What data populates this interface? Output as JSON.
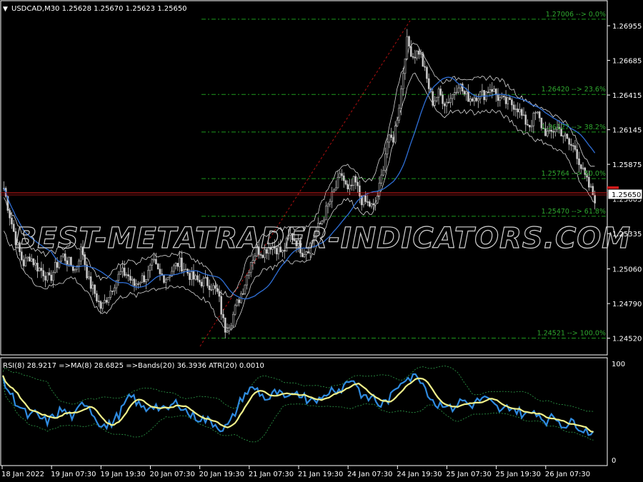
{
  "main_panel": {
    "header": "USDCAD,M30  1.25628 1.25670 1.25623 1.25650",
    "price_axis_ticks": [
      "1.26955",
      "1.26685",
      "1.26415",
      "1.26145",
      "1.25875",
      "1.25605",
      "1.25335",
      "1.25060",
      "1.24790",
      "1.24520"
    ],
    "current_price": "1.25650",
    "fib_levels": [
      {
        "label": "1.27006 --> 0.0%",
        "price": 1.27006
      },
      {
        "label": "1.26420 --> 23.6%",
        "price": 1.2642
      },
      {
        "label": "1.26127 --> 38.2%",
        "price": 1.26127
      },
      {
        "label": "1.25764 --> 50.0%",
        "price": 1.25764
      },
      {
        "label": "1.25470 --> 61.8%",
        "price": 1.2547
      },
      {
        "label": "1.24521 --> 100.0%",
        "price": 1.24521
      }
    ],
    "watermark": "BEST-METATRADER-INDICATORS.COM"
  },
  "sub_panel": {
    "header": "RSI(8) 28.9217  =>MA(8) 28.6825  =>Bands(20) 36.3936  ATR(20) 0.0010",
    "axis_ticks": [
      "100",
      "0"
    ]
  },
  "time_axis": [
    "18 Jan 2022",
    "19 Jan 07:30",
    "19 Jan 19:30",
    "20 Jan 07:30",
    "20 Jan 19:30",
    "21 Jan 07:30",
    "21 Jan 19:30",
    "24 Jan 07:30",
    "24 Jan 19:30",
    "25 Jan 07:30",
    "25 Jan 19:30",
    "26 Jan 07:30"
  ],
  "colors": {
    "background": "#000000",
    "grid": "#ffffff",
    "candle": "#c8c8c8",
    "fib": "#1e9a1e",
    "fib_label": "#2fa82f",
    "ma": "#2f6fd6",
    "rsi": "#2f8be0",
    "rsi_ma": "#f0f08a",
    "band": "#2ea04a",
    "current_line": "#d11a1a",
    "diag": "#b01010"
  },
  "chart_data": {
    "type": "candlestick",
    "symbol": "USDCAD",
    "timeframe": "M30",
    "price_range": [
      1.2439,
      1.2715
    ],
    "close_path": [
      1.2569,
      1.2546,
      1.2525,
      1.251,
      1.2516,
      1.2508,
      1.2504,
      1.2497,
      1.2508,
      1.2517,
      1.2511,
      1.2505,
      1.2523,
      1.2497,
      1.2487,
      1.2475,
      1.2485,
      1.2495,
      1.2503,
      1.2502,
      1.2493,
      1.2498,
      1.25,
      1.2511,
      1.2501,
      1.2499,
      1.2506,
      1.2511,
      1.2505,
      1.2499,
      1.2496,
      1.2496,
      1.2493,
      1.2486,
      1.2459,
      1.2466,
      1.248,
      1.2493,
      1.2512,
      1.2521,
      1.2519,
      1.2525,
      1.2522,
      1.2518,
      1.2533,
      1.2528,
      1.2519,
      1.2523,
      1.2534,
      1.2544,
      1.2556,
      1.2568,
      1.258,
      1.2565,
      1.2575,
      1.256,
      1.2557,
      1.2553,
      1.2573,
      1.2605,
      1.2608,
      1.2638,
      1.2684,
      1.2672,
      1.2676,
      1.2656,
      1.2636,
      1.2643,
      1.2635,
      1.2641,
      1.2651,
      1.2641,
      1.2639,
      1.2642,
      1.2642,
      1.2648,
      1.264,
      1.2636,
      1.2635,
      1.2633,
      1.2622,
      1.2618,
      1.2628,
      1.2615,
      1.261,
      1.2617,
      1.2612,
      1.2603,
      1.26,
      1.2583,
      1.2571,
      1.2561
    ],
    "rsi_path": [
      82,
      70,
      60,
      52,
      44,
      48,
      42,
      40,
      46,
      52,
      48,
      44,
      56,
      60,
      46,
      38,
      34,
      40,
      48,
      60,
      66,
      56,
      52,
      58,
      54,
      50,
      56,
      60,
      52,
      46,
      44,
      42,
      40,
      36,
      32,
      38,
      52,
      66,
      72,
      74,
      66,
      62,
      70,
      66,
      60,
      72,
      68,
      62,
      66,
      60,
      70,
      74,
      72,
      80,
      84,
      70,
      62,
      66,
      56,
      60,
      66,
      78,
      86,
      84,
      88,
      76,
      64,
      56,
      60,
      52,
      58,
      62,
      56,
      60,
      64,
      60,
      54,
      50,
      56,
      52,
      48,
      46,
      52,
      44,
      40,
      46,
      38,
      36,
      40,
      34,
      30,
      29
    ],
    "rsi_ma_current": 28.6825,
    "rsi_current": 28.9217,
    "bands_current": 36.3936,
    "atr_current": 0.001
  }
}
